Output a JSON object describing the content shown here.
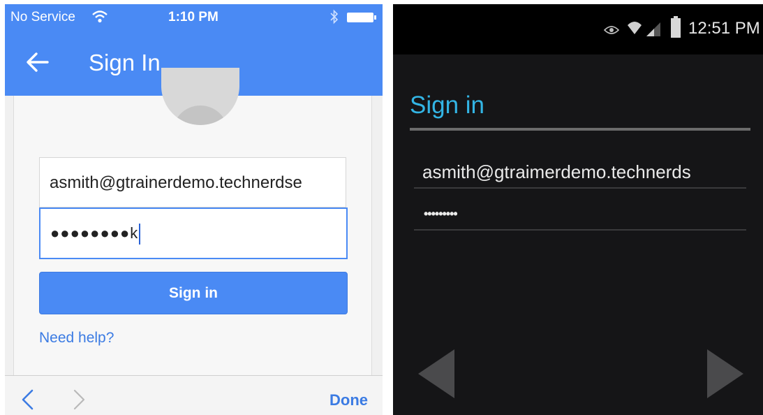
{
  "ios": {
    "status": {
      "carrier": "No Service",
      "time": "1:10 PM"
    },
    "header": {
      "title": "Sign In"
    },
    "form": {
      "email_value": "asmith@gtrainerdemo.technerdse",
      "password_value": "●●●●●●●●k",
      "signin_label": "Sign in",
      "help_label": "Need help?"
    },
    "toolbar": {
      "done_label": "Done"
    },
    "colors": {
      "accent": "#4a8af4",
      "link": "#3b7be3"
    }
  },
  "android": {
    "status": {
      "time": "12:51 PM"
    },
    "header": {
      "title": "Sign in"
    },
    "form": {
      "email_value": "asmith@gtraimerdemo.technerds",
      "password_value": "•••••••••"
    },
    "colors": {
      "accent": "#33b5e5",
      "background": "#151517"
    }
  }
}
